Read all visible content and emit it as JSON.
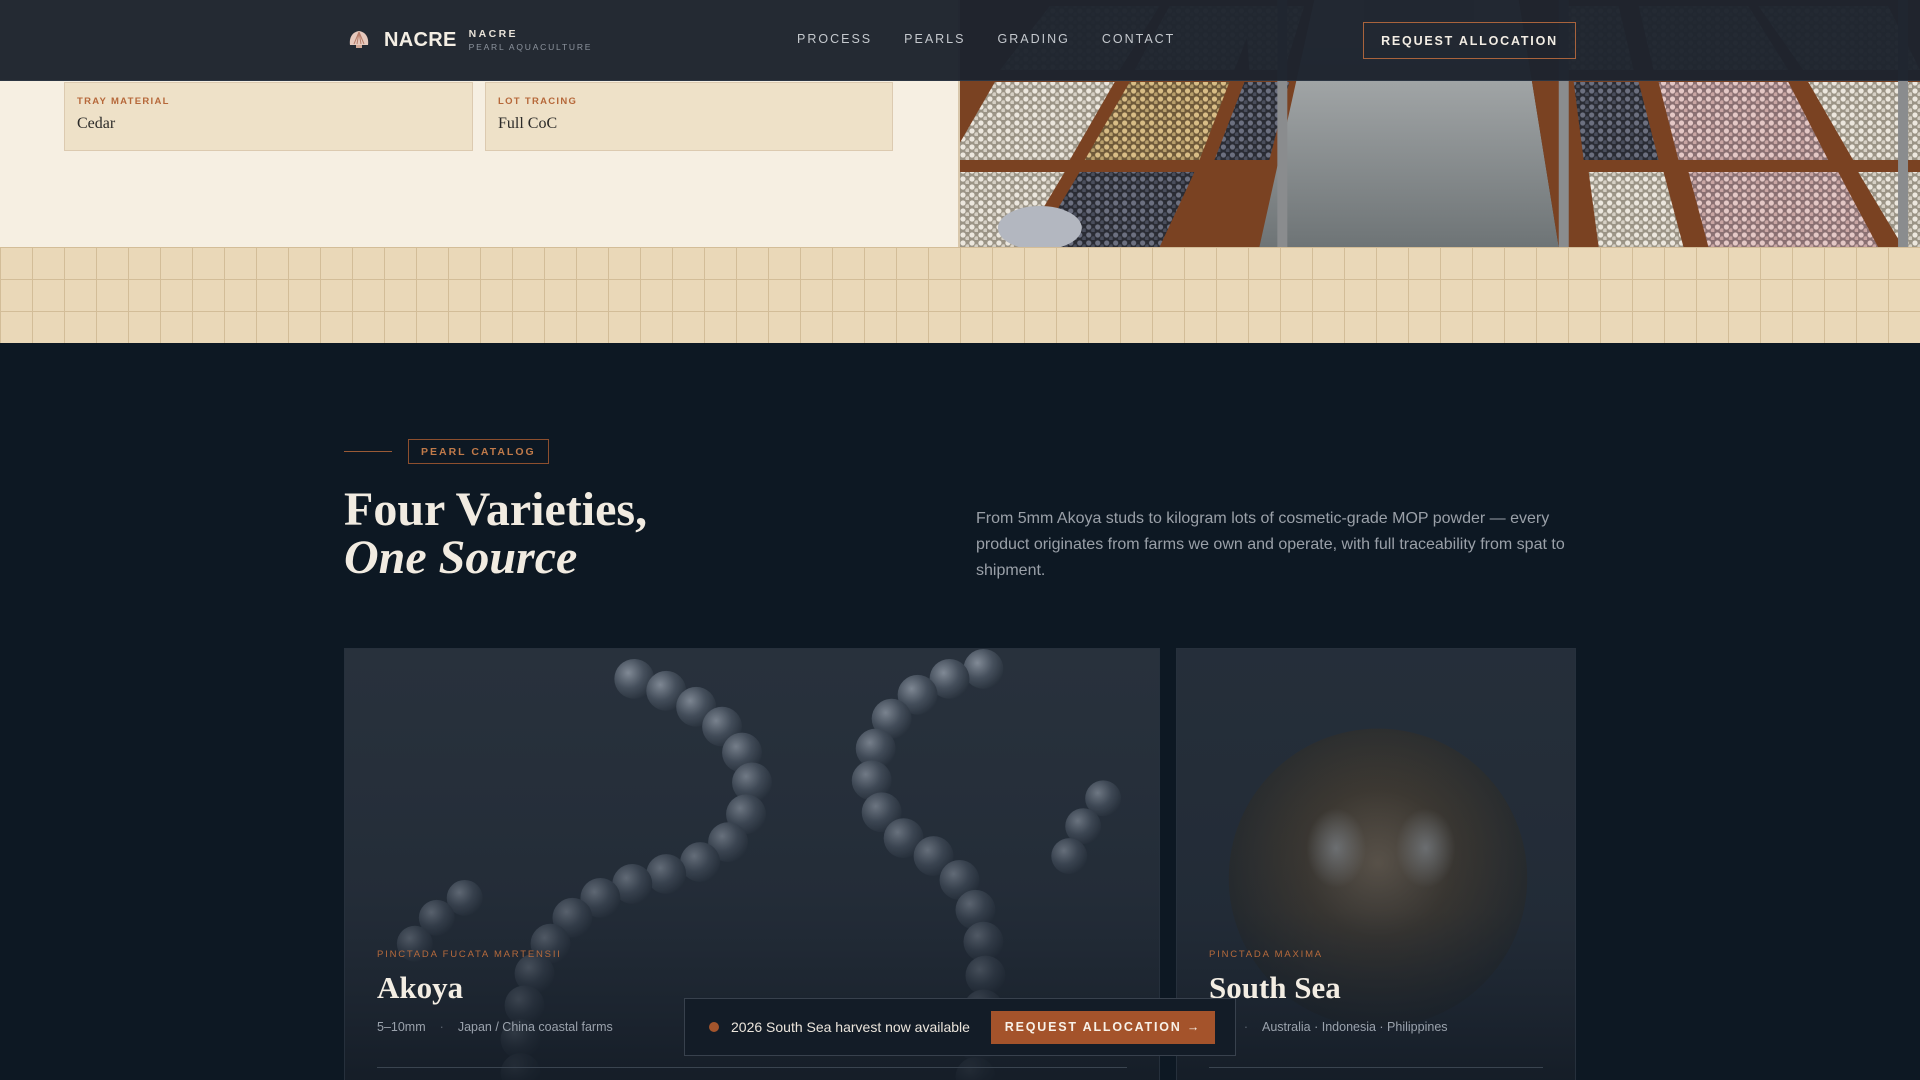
{
  "header": {
    "brand_name": "NACRE",
    "brand_sub_top": "NACRE",
    "brand_sub_bottom": "PEARL AQUACULTURE",
    "nav": [
      "PROCESS",
      "PEARLS",
      "GRADING",
      "CONTACT"
    ],
    "cta_label": "REQUEST ALLOCATION",
    "logo_icon": "shell-icon"
  },
  "specs": [
    {
      "label": "TRAY MATERIAL",
      "value": "Cedar"
    },
    {
      "label": "LOT TRACING",
      "value": "Full CoC"
    }
  ],
  "catalog": {
    "eyebrow": "PEARL CATALOG",
    "heading_line1": "Four Varieties,",
    "heading_line2": "One Source",
    "intro": "From 5mm Akoya studs to kilogram lots of cosmetic-grade MOP powder — every product originates from farms we own and operate, with full traceability from spat to shipment.",
    "cards": [
      {
        "species": "PINCTADA FUCATA MARTENSII",
        "name": "Akoya",
        "size": "5–10mm",
        "origin": "Japan / China coastal farms"
      },
      {
        "species": "PINCTADA MAXIMA",
        "name": "South Sea",
        "size": "mm",
        "origin": "Australia · Indonesia · Philippines"
      }
    ]
  },
  "banner": {
    "text": "2026 South Sea harvest now available",
    "cta_label": "REQUEST ALLOCATION →"
  },
  "colors": {
    "accent": "#a4532b",
    "navy": "#0d1823",
    "cream": "#f6efe2"
  }
}
